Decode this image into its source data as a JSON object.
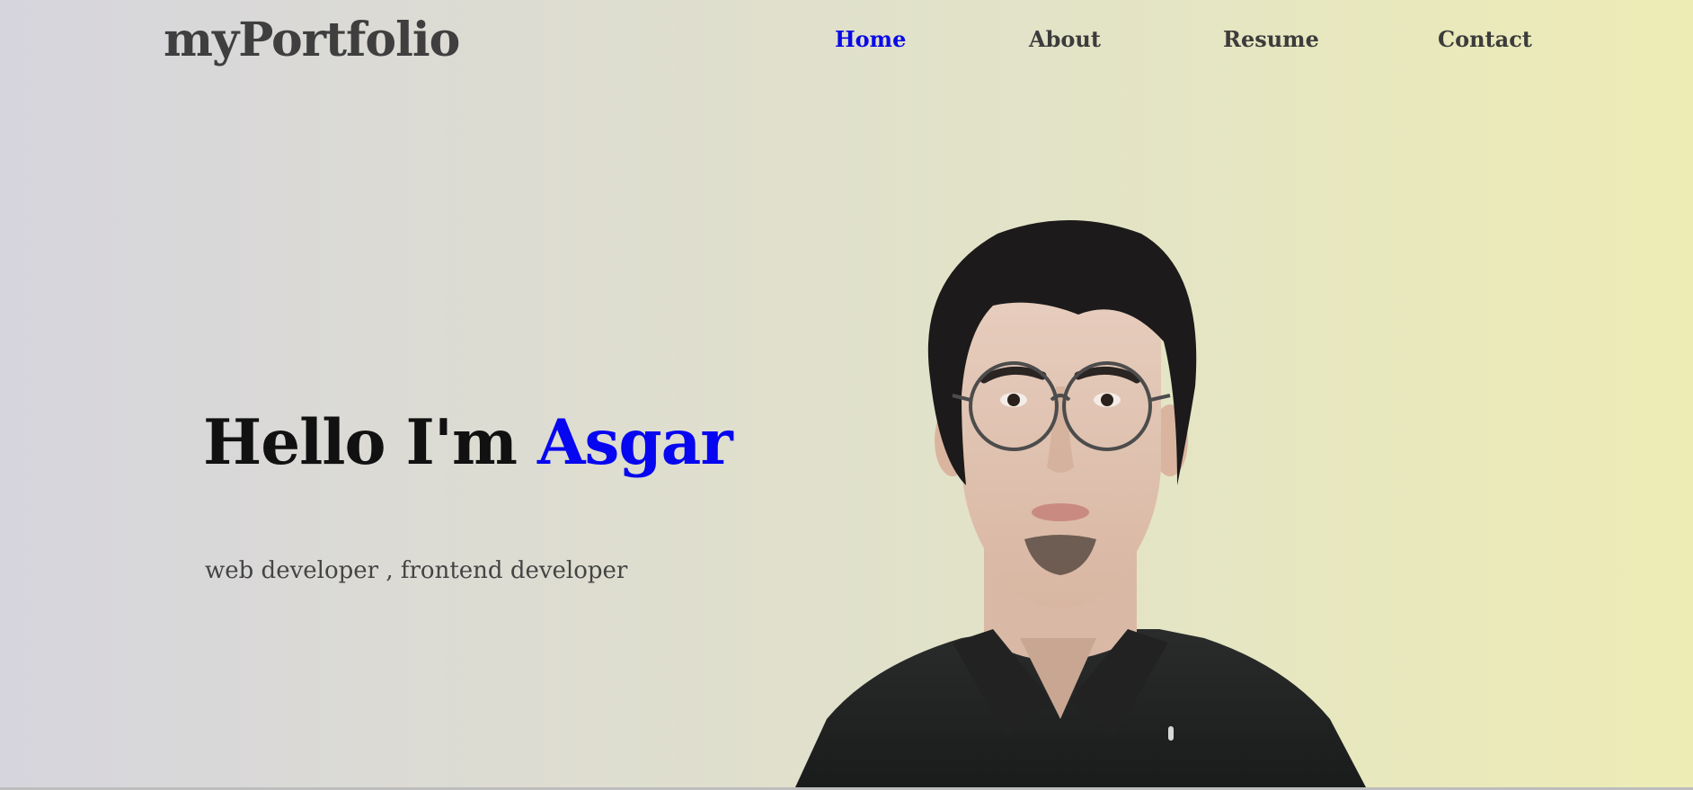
{
  "header": {
    "logo": "myPortfolio",
    "nav": [
      {
        "label": "Home",
        "active": true
      },
      {
        "label": "About",
        "active": false
      },
      {
        "label": "Resume",
        "active": false
      },
      {
        "label": "Contact",
        "active": false
      }
    ]
  },
  "hero": {
    "greeting": "Hello I'm",
    "name": "Asgar",
    "subtitle": "web developer , frontend developer",
    "portrait_icon": "profile-photo"
  },
  "colors": {
    "accent": "#0606f0",
    "nav_text": "#3c3c3c",
    "logo_text": "#3f3f3f",
    "heading_text": "#111111",
    "bg_left": "#d6d5dd",
    "bg_right": "#eeecb5"
  }
}
